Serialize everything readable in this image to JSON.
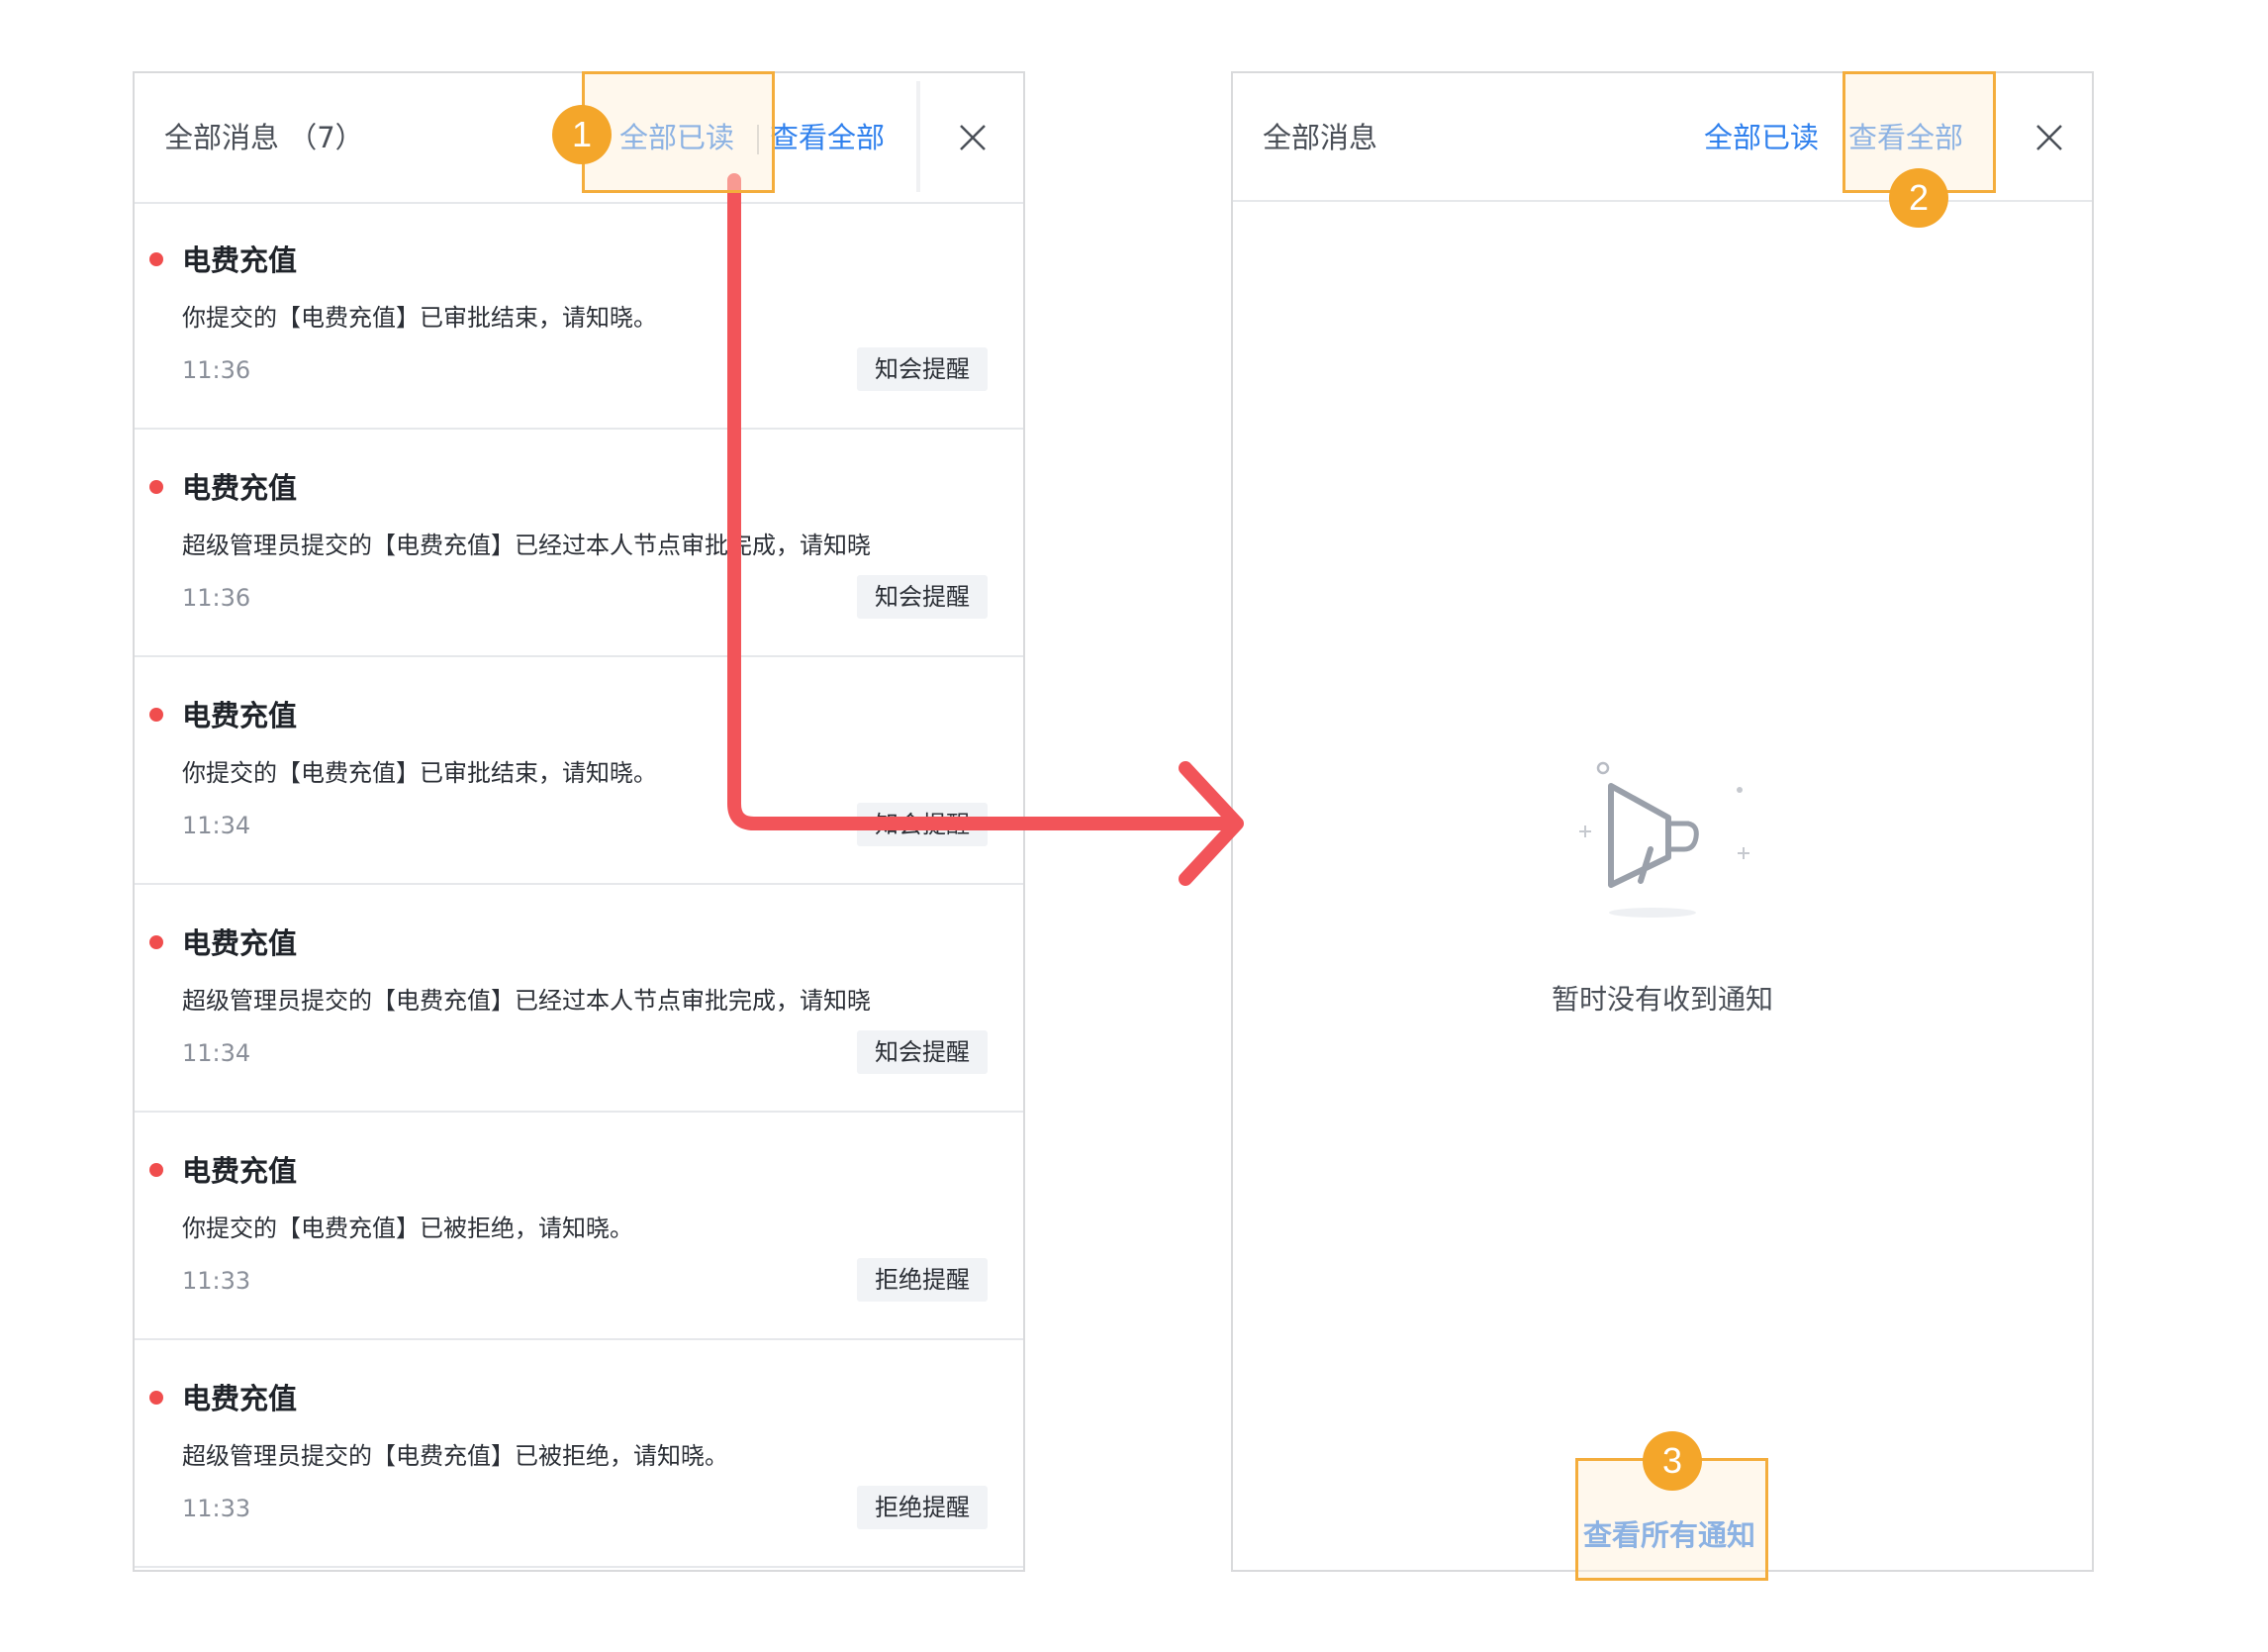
{
  "left_panel": {
    "title": "全部消息",
    "count": "（7）",
    "mark_all_read": "全部已读",
    "view_all": "查看全部",
    "messages": [
      {
        "title": "电费充值",
        "body": "你提交的【电费充值】已审批结束，请知晓。",
        "time": "11:36",
        "tag": "知会提醒"
      },
      {
        "title": "电费充值",
        "body": "超级管理员提交的【电费充值】已经过本人节点审批完成，请知晓",
        "time": "11:36",
        "tag": "知会提醒"
      },
      {
        "title": "电费充值",
        "body": "你提交的【电费充值】已审批结束，请知晓。",
        "time": "11:34",
        "tag": "知会提醒"
      },
      {
        "title": "电费充值",
        "body": "超级管理员提交的【电费充值】已经过本人节点审批完成，请知晓",
        "time": "11:34",
        "tag": "知会提醒"
      },
      {
        "title": "电费充值",
        "body": "你提交的【电费充值】已被拒绝，请知晓。",
        "time": "11:33",
        "tag": "拒绝提醒"
      },
      {
        "title": "电费充值",
        "body": "超级管理员提交的【电费充值】已被拒绝，请知晓。",
        "time": "11:33",
        "tag": "拒绝提醒"
      }
    ]
  },
  "right_panel": {
    "title": "全部消息",
    "mark_all_read": "全部已读",
    "view_all": "查看全部",
    "empty_text": "暂时没有收到通知",
    "view_all_notices": "查看所有通知"
  },
  "annotations": {
    "step_1": "1",
    "step_2": "2",
    "step_3": "3"
  },
  "colors": {
    "link": "#2f80ed",
    "unread_dot": "#f04d4d",
    "highlight_border": "#f4ad3c",
    "badge": "#f4a62a",
    "arrow": "#f25459"
  },
  "icons": [
    "close-icon",
    "megaphone-icon",
    "arrow-right-icon"
  ]
}
